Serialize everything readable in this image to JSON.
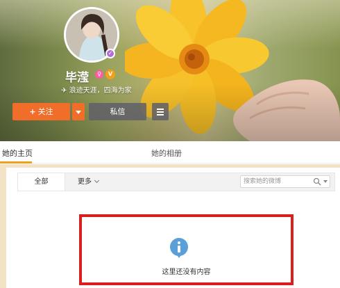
{
  "profile": {
    "username": "毕滢",
    "bio": "浪迹天涯，四海为家",
    "gender_icon": "female-icon",
    "vip_icon": "vip-icon",
    "verified_icon": "verified-badge-icon"
  },
  "actions": {
    "follow_label": "关注",
    "follow_plus": "+",
    "message_label": "私信"
  },
  "tabs": [
    {
      "label": "她的主页",
      "active": true
    },
    {
      "label": "她的相册",
      "active": false
    }
  ],
  "filter": {
    "all_label": "全部",
    "more_label": "更多",
    "search_placeholder": "搜索她的微博"
  },
  "empty_state": {
    "message": "这里还没有内容",
    "icon": "info-icon"
  },
  "colors": {
    "accent_orange": "#f06d2a",
    "tab_underline": "#f2a01a",
    "highlight_border": "#d91e1e",
    "info_blue": "#5a9fd8"
  }
}
